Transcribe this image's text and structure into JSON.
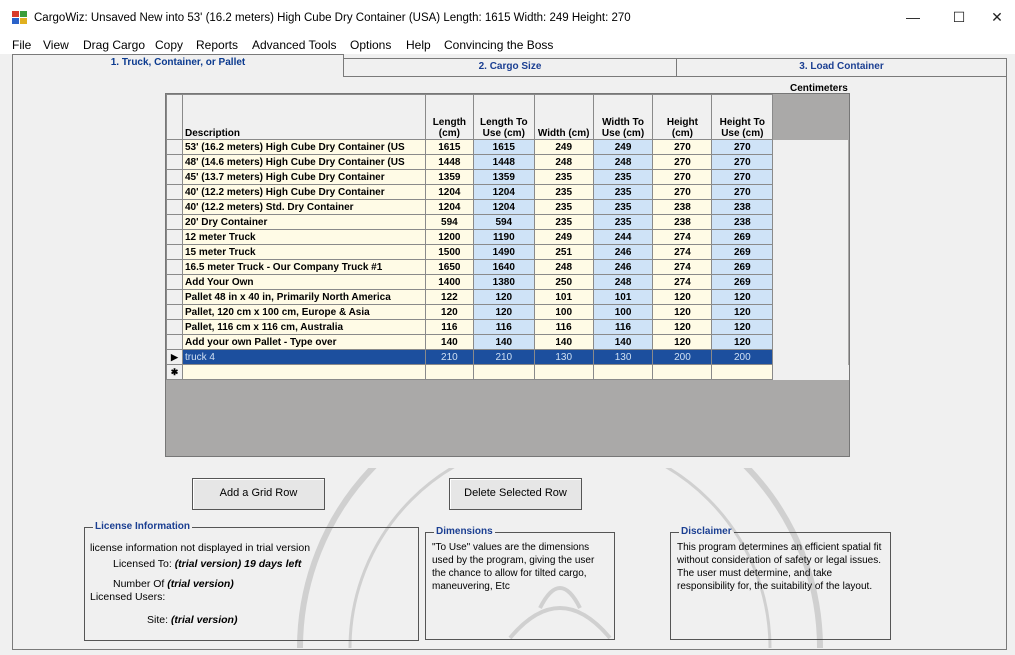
{
  "window": {
    "title": "CargoWiz:  Unsaved New into  53' (16.2 meters) High Cube Dry Container (USA)   Length: 1615  Width: 249  Height: 270",
    "minimize": "—",
    "maximize": "☐",
    "close": "✕"
  },
  "menu": [
    "File",
    "View",
    "Drag Cargo",
    "Copy",
    "Reports",
    "Advanced Tools",
    "Options",
    "Help",
    "Convincing the Boss"
  ],
  "tabs": [
    "1. Truck, Container, or Pallet",
    "2. Cargo Size",
    "3. Load Container"
  ],
  "units_label": "Centimeters",
  "grid": {
    "columns": [
      "Description",
      "Length (cm)",
      "Length To Use (cm)",
      "Width (cm)",
      "Width To Use (cm)",
      "Height (cm)",
      "Height To Use (cm)"
    ],
    "rows": [
      [
        "53' (16.2 meters) High Cube Dry Container (US",
        "1615",
        "1615",
        "249",
        "249",
        "270",
        "270"
      ],
      [
        "48' (14.6 meters) High Cube Dry Container (US",
        "1448",
        "1448",
        "248",
        "248",
        "270",
        "270"
      ],
      [
        "45' (13.7 meters) High Cube Dry Container",
        "1359",
        "1359",
        "235",
        "235",
        "270",
        "270"
      ],
      [
        "40' (12.2 meters) High Cube Dry Container",
        "1204",
        "1204",
        "235",
        "235",
        "270",
        "270"
      ],
      [
        "40' (12.2 meters) Std. Dry Container",
        "1204",
        "1204",
        "235",
        "235",
        "238",
        "238"
      ],
      [
        "20' Dry Container",
        "594",
        "594",
        "235",
        "235",
        "238",
        "238"
      ],
      [
        "12 meter Truck",
        "1200",
        "1190",
        "249",
        "244",
        "274",
        "269"
      ],
      [
        "15 meter Truck",
        "1500",
        "1490",
        "251",
        "246",
        "274",
        "269"
      ],
      [
        "16.5 meter Truck -  Our Company Truck #1",
        "1650",
        "1640",
        "248",
        "246",
        "274",
        "269"
      ],
      [
        "Add Your Own",
        "1400",
        "1380",
        "250",
        "248",
        "274",
        "269"
      ],
      [
        "Pallet  48 in x 40 in, Primarily North America",
        "122",
        "120",
        "101",
        "101",
        "120",
        "120"
      ],
      [
        "Pallet, 120 cm x 100 cm, Europe & Asia",
        "120",
        "120",
        "100",
        "100",
        "120",
        "120"
      ],
      [
        "Pallet, 116 cm x 116 cm, Australia",
        "116",
        "116",
        "116",
        "116",
        "120",
        "120"
      ],
      [
        "Add your own Pallet - Type over",
        "140",
        "140",
        "140",
        "140",
        "120",
        "120"
      ],
      [
        "truck 4",
        "210",
        "210",
        "130",
        "130",
        "200",
        "200"
      ]
    ],
    "selected_marker": "▶",
    "new_row_marker": "✱"
  },
  "buttons": {
    "add_row": "Add a Grid Row",
    "delete_row": "Delete Selected Row"
  },
  "license": {
    "legend": "License Information",
    "note": "license information not displayed in trial version",
    "licensed_to_label": "Licensed To:",
    "licensed_to_value": "(trial version)  19 days left",
    "number_of_label": "Number Of",
    "number_of_value": "(trial version)",
    "licensed_users_label": "Licensed Users:",
    "site_label": "Site:",
    "site_value": "(trial version)"
  },
  "dimensions": {
    "legend": "Dimensions",
    "text": "\"To Use\" values are the dimensions used by the program, giving the user the chance to allow for tilted cargo, maneuvering, Etc"
  },
  "disclaimer": {
    "legend": "Disclaimer",
    "text": "This program determines an efficient spatial fit without consideration of safety or legal issues. The user must determine, and take responsibility for, the suitability of the layout."
  }
}
